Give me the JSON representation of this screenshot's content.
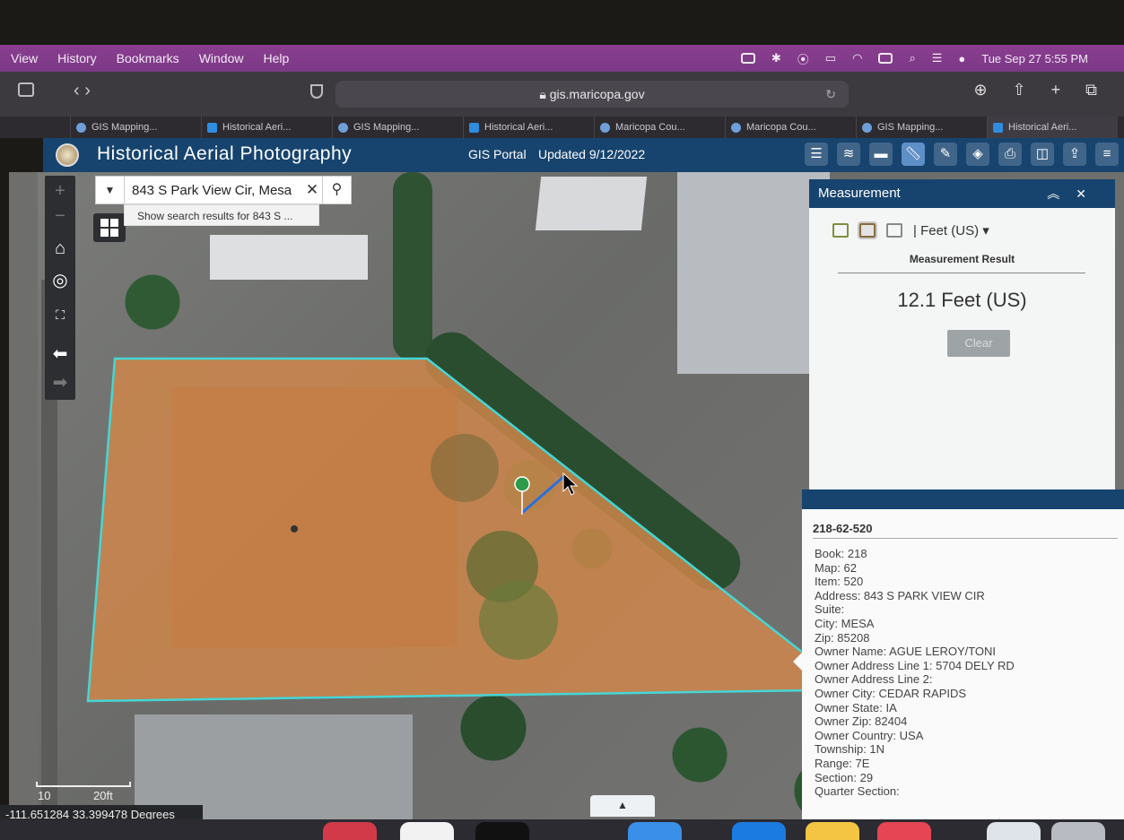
{
  "menubar": {
    "items": [
      "View",
      "History",
      "Bookmarks",
      "Window",
      "Help"
    ],
    "datetime": "Tue Sep 27  5:55 PM"
  },
  "browser": {
    "url": "gis.maricopa.gov",
    "tabs": [
      {
        "label": "GIS Mapping..."
      },
      {
        "label": "Historical Aeri..."
      },
      {
        "label": "GIS Mapping..."
      },
      {
        "label": "Historical Aeri..."
      },
      {
        "label": "Maricopa Cou..."
      },
      {
        "label": "Maricopa Cou..."
      },
      {
        "label": "GIS Mapping..."
      },
      {
        "label": "Historical Aeri..."
      }
    ]
  },
  "app": {
    "title": "Historical Aerial Photography",
    "portal_label": "GIS Portal",
    "updated": "Updated 9/12/2022"
  },
  "search": {
    "value": "843 S Park View Cir, Mesa",
    "suggestion": "Show search results for 843 S ..."
  },
  "measurement": {
    "title": "Measurement",
    "unit": "Feet (US)",
    "result_label": "Measurement Result",
    "result": "12.1 Feet (US)",
    "clear_label": "Clear"
  },
  "parcel": {
    "id": "218-62-520",
    "lines": [
      "Book: 218",
      "Map: 62",
      "Item: 520",
      "Address: 843 S PARK VIEW CIR",
      "Suite:",
      "City: MESA",
      "Zip: 85208",
      "Owner Name: AGUE LEROY/TONI",
      "Owner Address Line 1: 5704 DELY RD",
      "Owner Address Line 2:",
      "Owner City: CEDAR RAPIDS",
      "Owner State: IA",
      "Owner Zip: 82404",
      "Owner Country: USA",
      "Township: 1N",
      "Range: 7E",
      "Section: 29",
      "Quarter Section:"
    ]
  },
  "footer": {
    "coordinates": "-111.651284 33.399478 Degrees",
    "scale_labels": [
      "10",
      "20ft"
    ]
  },
  "colors": {
    "header_blue": "#17446e",
    "parcel_fill": "#d2874a",
    "parcel_outline": "#45d6d6",
    "measure_line": "#2a6ee0",
    "marker": "#2e9a4b"
  }
}
